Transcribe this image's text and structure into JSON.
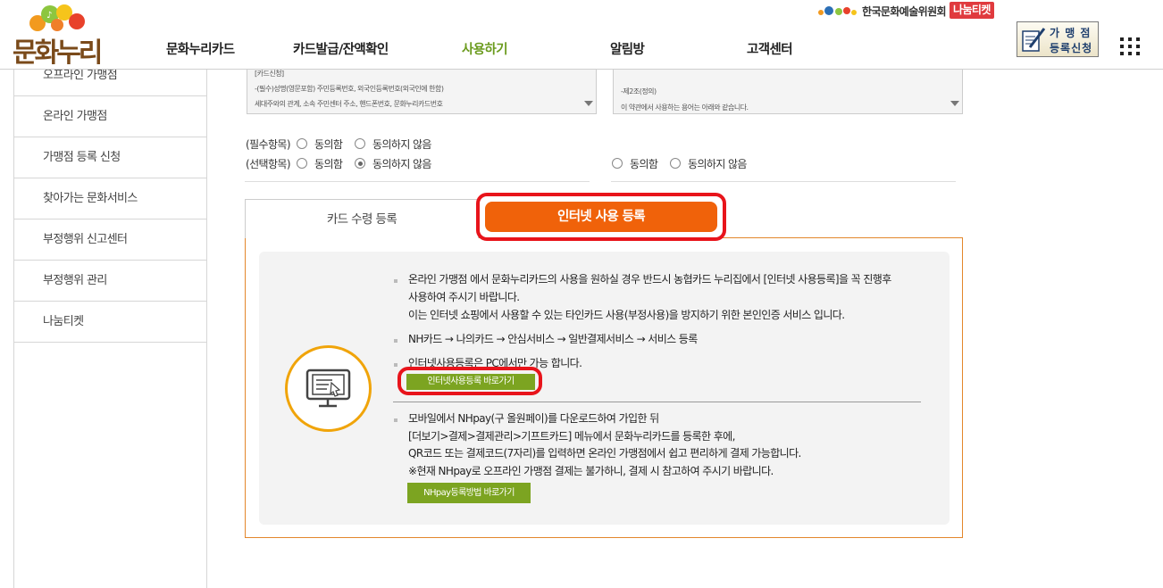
{
  "header": {
    "logo_text": "문화누리",
    "nav": [
      {
        "label": "문화누리카드",
        "active": false
      },
      {
        "label": "카드발급/잔액확인",
        "active": false
      },
      {
        "label": "사용하기",
        "active": true
      },
      {
        "label": "알림방",
        "active": false
      },
      {
        "label": "고객센터",
        "active": false
      }
    ],
    "org_name": "한국문화예술위원회",
    "org_badge": "나눔티켓",
    "register_line1": "가 맹 점",
    "register_line2": "등록신청"
  },
  "sidebar": {
    "items": [
      "오프라인 가맹점",
      "온라인 가맹점",
      "가맹점 등록 신청",
      "찾아가는 문화서비스",
      "부정행위 신고센터",
      "부정행위 관리",
      "나눔티켓"
    ]
  },
  "terms": {
    "left_lines": [
      "[카드신청]",
      "-(필수)성명(영문포함) 주민등록번호, 외국인등록번호(외국인에 한함)",
      "세대주와의 관계, 소속 주민센터 주소, 핸드폰번호, 문화누리카드번호"
    ],
    "right_lines": [
      "-제2조(정의)",
      "이 약관에서 사용하는 용어는 아래와 같습니다."
    ],
    "required_label": "(필수항목)",
    "optional_label": "(선택항목)",
    "agree": "동의함",
    "disagree": "동의하지 않음"
  },
  "tabs": {
    "card_receipt": "카드 수령 등록",
    "internet_use": "인터넷 사용 등록"
  },
  "content": {
    "p1_line1": "온라인 가맹점 에서 문화누리카드의 사용을 원하실 경우 반드시 농협카드 누리집에서 [인터넷 사용등록]을 꼭 진행후",
    "p1_line2": "사용하여 주시기 바랍니다.",
    "p1_line3": "이는 인터넷 쇼핑에서 사용할 수 있는 타인카드 사용(부정사용)을 방지하기 위한 본인인증 서비스 입니다.",
    "p2": "NH카드 → 나의카드 → 안심서비스 → 일반결제서비스 → 서비스 등록",
    "p3": "인터넷사용등록은 PC에서만 가능 합니다.",
    "btn_internet": "인터넷사용등록 바로가기",
    "p4_line1": "모바일에서 NHpay(구 올원페이)를 다운로드하여 가입한 뒤",
    "p4_line2": "[더보기>결제>결제관리>기프트카드] 메뉴에서 문화누리카드를 등록한 후에,",
    "p4_line3": "QR코드 또는 결제코드(7자리)를 입력하면 온라인 가맹점에서 쉽고 편리하게 결제 가능합니다.",
    "p4_line4": "※현재 NHpay로 오프라인 가맹점 결제는 불가하니, 결제 시 참고하여 주시기 바랍니다.",
    "btn_nhpay": "NHpay등록방법 바로가기"
  },
  "colors": {
    "accent_orange": "#f0620a",
    "highlight_red": "#e8141b",
    "button_green": "#7ca421",
    "nav_active": "#6b9b1e"
  }
}
